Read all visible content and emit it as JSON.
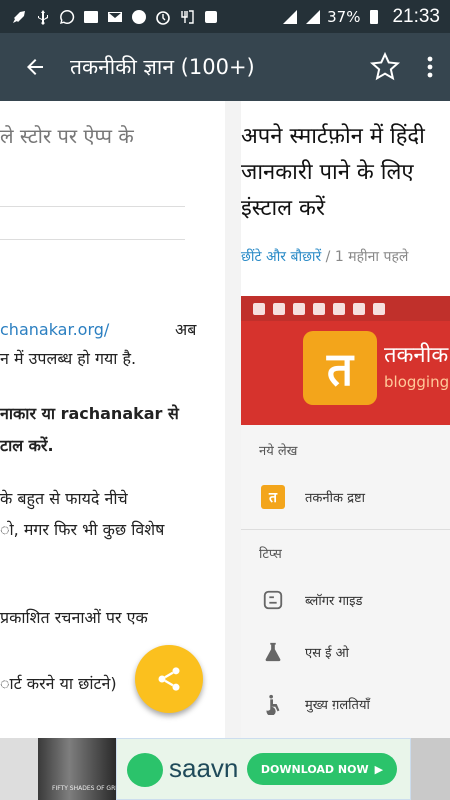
{
  "status_bar": {
    "battery": "37%",
    "time": "21:33",
    "icons": [
      "rocket-icon",
      "usb-icon",
      "whatsapp-icon",
      "wifi-icon",
      "gmail-icon",
      "settings-icon",
      "alarm-icon",
      "4g-icon",
      "android-icon",
      "signal-icon",
      "signal-icon",
      "battery-icon"
    ]
  },
  "app_bar": {
    "title": "तकनीकी ज्ञान (100+)"
  },
  "left_article": {
    "title_fragment": "ले स्टोर पर ऐप्प के",
    "lines": [
      {
        "text": "chanakar.org/",
        "extra": "अब"
      },
      {
        "text": "न में उपलब्ध हो गया है."
      },
      {
        "text": "नाकार या rachanakar से"
      },
      {
        "text": "टाल करें."
      },
      {
        "text": "के बहुत से फायदे नीचे"
      },
      {
        "text": "ो, मगर फिर भी कुछ विशेष"
      },
      {
        "text": "प्रकाशित रचनाओं पर एक"
      },
      {
        "text": "ार्ट करने या छांटने)"
      }
    ]
  },
  "right_article": {
    "title_line1": "अपने स्मार्टफ़ोन में हिंदी",
    "title_line2": "जानकारी पाने के लिए",
    "title_line3": "इंस्टाल करें",
    "category": "छींटे और बौछारें",
    "meta_sep": " / ",
    "time_ago": "1 महीना पहले",
    "screenshot": {
      "logo_char": "त",
      "logo_text": "तकनीक",
      "logo_sub": "blogging",
      "section1": "नये लेख",
      "item1": "तकनीक द्रष्टा",
      "section2": "टिप्स",
      "item2": "ब्लॉगर गाइड",
      "item3": "एस ई ओ",
      "item4": "मुख्य ग़लतियाँ"
    }
  },
  "ad": {
    "brand": "saavn",
    "cta": "DOWNLOAD NOW",
    "poster_text": "FIFTY SHADES OF GREY"
  },
  "colors": {
    "status_bar": "#253138",
    "app_bar": "#36454f",
    "fab": "#fbc01e",
    "link": "#2b7fc1"
  }
}
